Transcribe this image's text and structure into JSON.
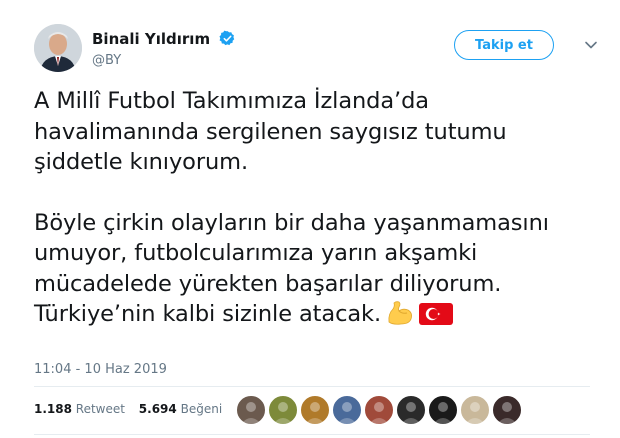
{
  "author": {
    "name": "Binali Yıldırım",
    "handle": "@BY",
    "verified_icon": "verified-badge-icon",
    "accent": "#1da1f2"
  },
  "actions": {
    "follow_label": "Takip et",
    "caret_icon": "chevron-down-icon"
  },
  "tweet": {
    "lines_p1": [
      "A Millî Futbol Takımımıza İzlanda’da",
      "havalimanında sergilenen saygısız tutumu",
      "şiddetle kınıyorum."
    ],
    "lines_p2": [
      "Böyle çirkin olayların bir daha yaşanmamasını",
      "umuyor, futbolcularımıza yarın akşamki",
      "mücadelede yürekten başarılar diliyorum.",
      "Türkiye’nin kalbi sizinle atacak."
    ],
    "emojis": [
      "flexed-biceps-icon",
      "turkey-flag-icon"
    ]
  },
  "timestamp": "11:04 - 10 Haz 2019",
  "stats": {
    "retweets_count": "1.188",
    "retweets_label": "Retweet",
    "likes_count": "5.694",
    "likes_label": "Beğeni"
  },
  "likers": [
    {
      "icon": "liker-avatar-1",
      "color": "#6b5a4e"
    },
    {
      "icon": "liker-avatar-2",
      "color": "#7d8a3a"
    },
    {
      "icon": "liker-avatar-3",
      "color": "#b07a2a"
    },
    {
      "icon": "liker-avatar-4",
      "color": "#4a6a9a"
    },
    {
      "icon": "liker-avatar-5",
      "color": "#a04a3a"
    },
    {
      "icon": "liker-avatar-6",
      "color": "#2a2a2a"
    },
    {
      "icon": "liker-avatar-7",
      "color": "#1a1a1a"
    },
    {
      "icon": "liker-avatar-8",
      "color": "#c9b89a"
    },
    {
      "icon": "liker-avatar-9",
      "color": "#3a2a2a"
    }
  ]
}
